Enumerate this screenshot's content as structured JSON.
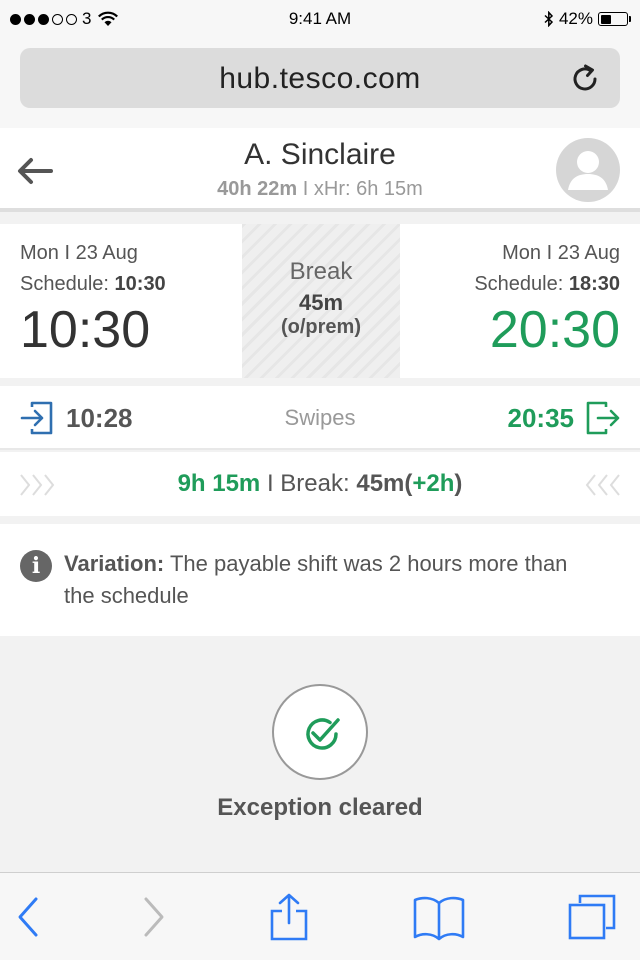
{
  "status_bar": {
    "carrier": "3",
    "time": "9:41 AM",
    "bluetooth": "bluetooth-icon",
    "battery_text": "42%",
    "battery_level": 0.42
  },
  "browser": {
    "url": "hub.tesco.com",
    "reload_icon": "reload-icon"
  },
  "profile": {
    "name": "A. Sinclaire",
    "total_hours": "40h 22m",
    "separator": "I",
    "xhr_label": "xHr: 6h 15m"
  },
  "shift": {
    "start": {
      "date": "Mon I 23 Aug",
      "schedule_label": "Schedule:",
      "schedule_time": "10:30",
      "actual_time": "10:30"
    },
    "break": {
      "title": "Break",
      "duration": "45m",
      "note": "(o/prem)"
    },
    "end": {
      "date": "Mon I 23 Aug",
      "schedule_label": "Schedule:",
      "schedule_time": "18:30",
      "actual_time": "20:30"
    }
  },
  "swipes": {
    "in_time": "10:28",
    "label": "Swipes",
    "out_time": "20:35"
  },
  "totals": {
    "worked": "9h 15m",
    "separator": "I",
    "break_label": "Break:",
    "break_value": "45m",
    "open_paren": "(",
    "difference": "+2h",
    "close_paren": ")"
  },
  "variation": {
    "label": "Variation:",
    "text": "The payable shift was 2 hours more than the schedule"
  },
  "exception": {
    "label": "Exception cleared"
  },
  "colors": {
    "green": "#1f9c5a",
    "ios_blue": "#2f7bf5",
    "text_grey": "#555555"
  }
}
